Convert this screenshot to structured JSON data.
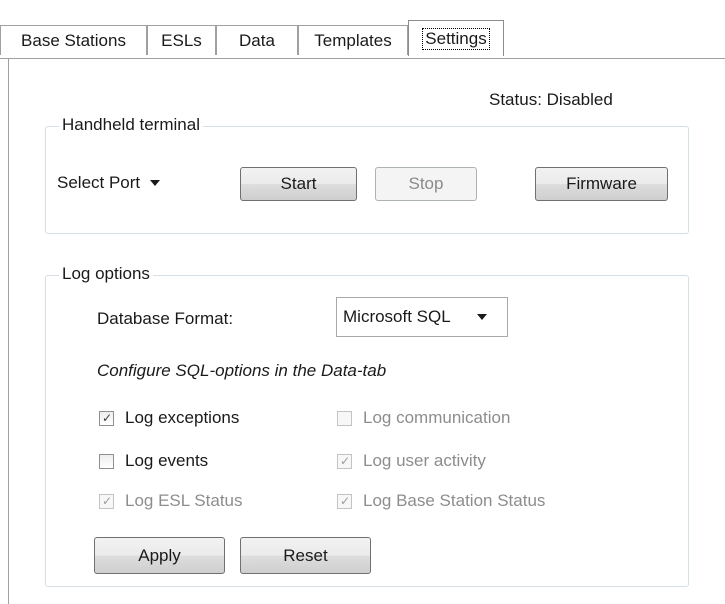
{
  "tabs": [
    {
      "label": "Base Stations",
      "active": false
    },
    {
      "label": "ESLs",
      "active": false
    },
    {
      "label": "Data",
      "active": false
    },
    {
      "label": "Templates",
      "active": false
    },
    {
      "label": "Settings",
      "active": true
    }
  ],
  "status_text": "Status: Disabled",
  "handheld": {
    "title": "Handheld terminal",
    "port_select": "Select Port",
    "start_label": "Start",
    "stop_label": "Stop",
    "firmware_label": "Firmware"
  },
  "log_options": {
    "title": "Log options",
    "db_format_label": "Database Format:",
    "db_format_value": "Microsoft SQL",
    "sql_hint": "Configure SQL-options in the Data-tab",
    "checkboxes": [
      {
        "label": "Log exceptions",
        "checked": true,
        "enabled": true
      },
      {
        "label": "Log communication",
        "checked": false,
        "enabled": false
      },
      {
        "label": "Log events",
        "checked": false,
        "enabled": true
      },
      {
        "label": "Log user activity",
        "checked": true,
        "enabled": false
      },
      {
        "label": "Log ESL Status",
        "checked": true,
        "enabled": false
      },
      {
        "label": "Log Base Station Status",
        "checked": true,
        "enabled": false
      }
    ],
    "apply_label": "Apply",
    "reset_label": "Reset"
  },
  "check_glyph": "✓"
}
